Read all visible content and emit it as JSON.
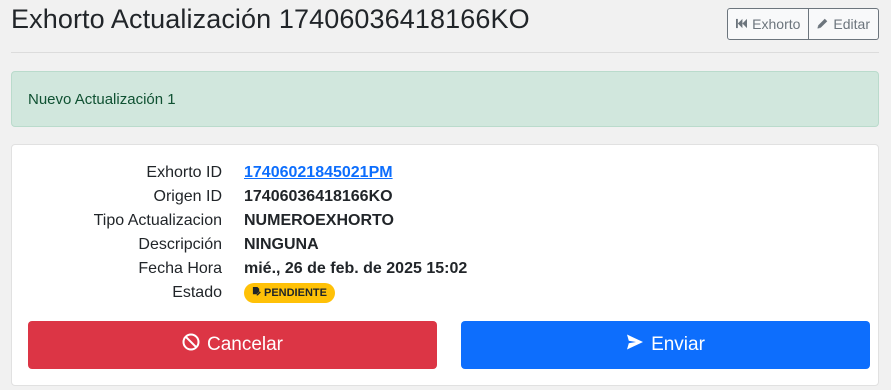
{
  "header": {
    "title": "Exhorto Actualización 17406036418166KO",
    "exhorto_button": "Exhorto",
    "editar_button": "Editar"
  },
  "alert": {
    "message": "Nuevo Actualización 1"
  },
  "details": [
    {
      "label": "Exhorto ID",
      "value": "17406021845021PM"
    },
    {
      "label": "Origen ID",
      "value": "17406036418166KO"
    },
    {
      "label": "Tipo Actualizacion",
      "value": "NUMEROEXHORTO"
    },
    {
      "label": "Descripción",
      "value": "NINGUNA"
    },
    {
      "label": "Fecha Hora",
      "value": "mié., 26 de feb. de 2025 15:02"
    },
    {
      "label": "Estado",
      "value": "PENDIENTE"
    }
  ],
  "actions": {
    "cancel_label": "Cancelar",
    "send_label": "Enviar"
  },
  "colors": {
    "danger": "#dc3545",
    "primary": "#0d6efd",
    "success_bg": "#d1e7dd",
    "warning": "#ffc107"
  },
  "icons": {
    "exhorto_button": "skip-back-icon",
    "editar_button": "pencil-icon",
    "estado_badge": "file-edit-icon",
    "cancel_button": "ban-icon",
    "send_button": "paper-plane-icon"
  }
}
